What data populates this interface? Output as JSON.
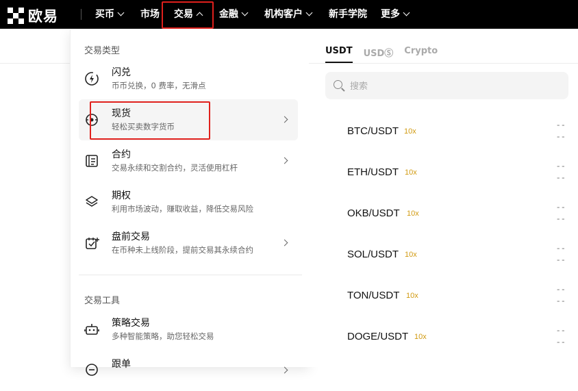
{
  "brand": {
    "name": "欧易"
  },
  "nav": {
    "items": [
      {
        "label": "买币",
        "has_dropdown": true
      },
      {
        "label": "市场",
        "has_dropdown": false
      },
      {
        "label": "交易",
        "has_dropdown": true,
        "open": true
      },
      {
        "label": "金融",
        "has_dropdown": true
      },
      {
        "label": "机构客户",
        "has_dropdown": true
      },
      {
        "label": "新手学院",
        "has_dropdown": false
      },
      {
        "label": "更多",
        "has_dropdown": true
      }
    ]
  },
  "dropdown": {
    "section_trade_types": "交易类型",
    "section_tools": "交易工具",
    "items": [
      {
        "title": "闪兑",
        "desc": "币币兑换，0 费率，无滑点",
        "icon": "lightning-icon",
        "has_arrow": false
      },
      {
        "title": "现货",
        "desc": "轻松买卖数字货币",
        "icon": "spot-icon",
        "has_arrow": true,
        "active": true
      },
      {
        "title": "合约",
        "desc": "交易永续和交割合约，灵活使用杠杆",
        "icon": "contract-icon",
        "has_arrow": true
      },
      {
        "title": "期权",
        "desc": "利用市场波动，赚取收益，降低交易风险",
        "icon": "layers-icon",
        "has_arrow": false
      },
      {
        "title": "盘前交易",
        "desc": "在币种未上线阶段，提前交易其永续合约",
        "icon": "calendar-icon",
        "has_arrow": true
      }
    ],
    "tools": [
      {
        "title": "策略交易",
        "desc": "多种智能策略，助您轻松交易",
        "icon": "bot-icon",
        "has_arrow": false
      },
      {
        "title": "跟单",
        "desc": "",
        "icon": "copy-icon",
        "has_arrow": true
      }
    ]
  },
  "market_panel": {
    "tabs": [
      "USDT",
      "USDⓈ",
      "Crypto"
    ],
    "active_tab": "USDT",
    "search_placeholder": "搜索",
    "pairs": [
      {
        "name": "BTC/USDT",
        "leverage": "10x",
        "price": "--",
        "change": "--"
      },
      {
        "name": "ETH/USDT",
        "leverage": "10x",
        "price": "--",
        "change": "--"
      },
      {
        "name": "OKB/USDT",
        "leverage": "10x",
        "price": "--",
        "change": "--"
      },
      {
        "name": "SOL/USDT",
        "leverage": "10x",
        "price": "--",
        "change": "--"
      },
      {
        "name": "TON/USDT",
        "leverage": "10x",
        "price": "--",
        "change": "--"
      },
      {
        "name": "DOGE/USDT",
        "leverage": "10x",
        "price": "--",
        "change": "--"
      }
    ]
  },
  "colors": {
    "highlight": "#e0201c",
    "leverage": "#d19a10",
    "topbar": "#000000"
  }
}
